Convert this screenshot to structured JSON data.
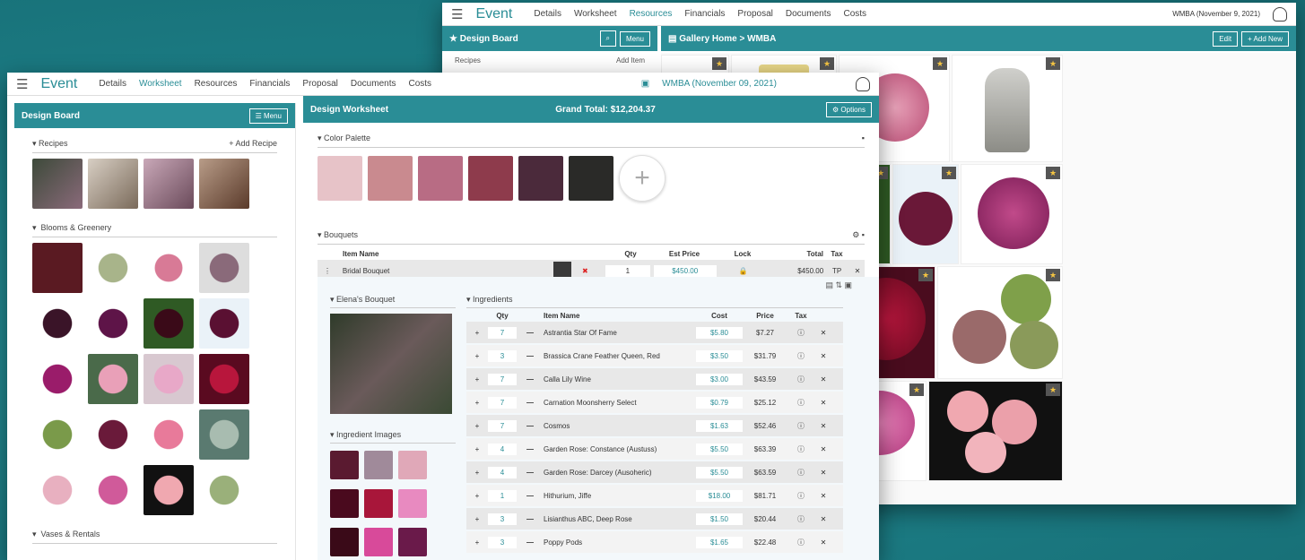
{
  "nav": {
    "brand": "Event",
    "items": [
      "Details",
      "Worksheet",
      "Resources",
      "Financials",
      "Proposal",
      "Documents",
      "Costs"
    ],
    "event_label": "WMBA (November 09, 2021)",
    "event_label_back": "WMBA (November 9, 2021)"
  },
  "back": {
    "design_board": "Design Board",
    "menu": "Menu",
    "recipes": "Recipes",
    "add_item": "Add Item",
    "breadcrumb": "Gallery Home > WMBA",
    "edit": "Edit",
    "add_new": "+ Add New"
  },
  "left": {
    "title": "Design Board",
    "menu": "Menu",
    "recipes": "Recipes",
    "add_recipe": "+ Add Recipe",
    "blooms": "Blooms & Greenery",
    "vases": "Vases & Rentals"
  },
  "worksheet": {
    "title": "Design Worksheet",
    "grand_total": "Grand Total: $12,204.37",
    "options": "Options",
    "color_palette": "Color Palette",
    "palette": [
      "#e7c3c8",
      "#c98a8f",
      "#b86c84",
      "#8e3b4c",
      "#4b2a3b",
      "#2a2a28"
    ],
    "bouquets": "Bouquets",
    "cols": {
      "name": "Item Name",
      "qty": "Qty",
      "est": "Est Price",
      "lock": "Lock",
      "total": "Total",
      "tax": "Tax"
    },
    "bouquet": {
      "name": "Bridal Bouquet",
      "qty": "1",
      "est": "$450.00",
      "total": "$450.00",
      "tax": "TP"
    },
    "recipe_title": "Elena's Bouquet",
    "ingredient_images": "Ingredient Images",
    "ingredients_title": "Ingredients",
    "icols": {
      "qty": "Qty",
      "name": "Item Name",
      "cost": "Cost",
      "price": "Price",
      "tax": "Tax"
    },
    "ingredients": [
      {
        "qty": "7",
        "name": "Astrantia Star Of Fame",
        "cost": "$5.80",
        "price": "$7.27"
      },
      {
        "qty": "3",
        "name": "Brassica Crane Feather Queen, Red",
        "cost": "$3.50",
        "price": "$31.79"
      },
      {
        "qty": "7",
        "name": "Calla Lily Wine",
        "cost": "$3.00",
        "price": "$43.59"
      },
      {
        "qty": "7",
        "name": "Carnation Moonsherry Select",
        "cost": "$0.79",
        "price": "$25.12"
      },
      {
        "qty": "7",
        "name": "Cosmos",
        "cost": "$1.63",
        "price": "$52.46"
      },
      {
        "qty": "4",
        "name": "Garden Rose: Constance (Austuss)",
        "cost": "$5.50",
        "price": "$63.39"
      },
      {
        "qty": "4",
        "name": "Garden Rose: Darcey (Ausoheric)",
        "cost": "$5.50",
        "price": "$63.59"
      },
      {
        "qty": "1",
        "name": "Hithurium, Jiffe",
        "cost": "$18.00",
        "price": "$81.71"
      },
      {
        "qty": "3",
        "name": "Lisianthus ABC, Deep Rose",
        "cost": "$1.50",
        "price": "$20.44"
      },
      {
        "qty": "3",
        "name": "Poppy Pods",
        "cost": "$1.65",
        "price": "$22.48"
      }
    ]
  },
  "colors": {
    "teal": "#2a8d96",
    "background": "#1d7f86"
  }
}
